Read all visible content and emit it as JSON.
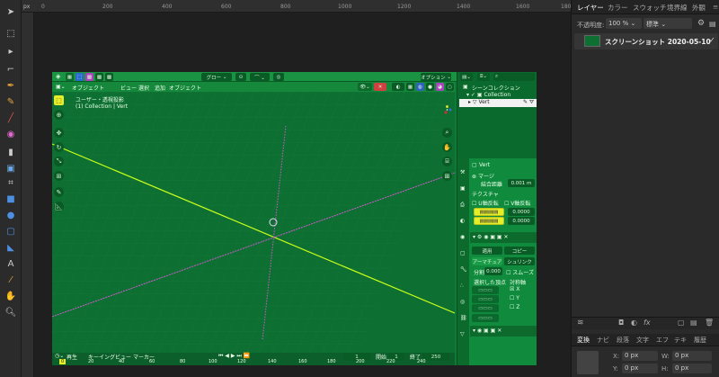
{
  "ruler": {
    "unit": "px",
    "h_ticks": [
      "0",
      "200",
      "400",
      "600",
      "800",
      "1000",
      "1200",
      "1400",
      "1600",
      "1800"
    ]
  },
  "layers_panel": {
    "tabs": [
      "レイヤー",
      "カラー",
      "スウォッチ",
      "境界線",
      "外観"
    ],
    "opacity_label": "不透明度:",
    "opacity_value": "100 %",
    "blend_mode": "標準",
    "layer_name": "スクリーンショット 2020-05-10",
    "layer_check": "✓"
  },
  "transform_panel": {
    "tabs": [
      "変換",
      "ナビ",
      "段落",
      "文字",
      "エフ",
      "テキ",
      "履歴"
    ],
    "x_label": "X:",
    "x_value": "0 px",
    "y_label": "Y:",
    "y_value": "0 px",
    "w_label": "W:",
    "w_value": "0 px",
    "h_label": "H:",
    "h_value": "0 px"
  },
  "blender": {
    "header_menus": [
      "オブジェクト",
      "ビュー",
      "選択",
      "追加",
      "オブジェクト"
    ],
    "transform_orientation": "グロー",
    "options_label": "オプション",
    "viewport_info_line1": "ユーザー・透視投影",
    "viewport_info_line2": "(1) Collection | Vert",
    "timeline_menus": [
      "再生",
      "キーイング",
      "ビュー",
      "マーカー"
    ],
    "timeline_current_frame": "1",
    "timeline_start_label": "開始",
    "timeline_start": "1",
    "timeline_end_label": "終了",
    "timeline_end": "250",
    "timeline_ticks": [
      "0",
      "20",
      "40",
      "60",
      "80",
      "100",
      "120",
      "140",
      "160",
      "180",
      "200",
      "220",
      "240"
    ],
    "outliner": {
      "title": "シーンコレクション",
      "collection": "Collection",
      "object": "Vert"
    },
    "props": {
      "object_name": "Vert",
      "section_merge": "マージ",
      "merge_label": "結合距離",
      "merge_value": "0.001 m",
      "section_texture": "テクスチャ",
      "u_label": "U軸反転",
      "v_label": "V軸反転",
      "field1": "0.0000",
      "field2": "0.0000",
      "apply_label": "適用",
      "copy_label": "コピー",
      "armature_label": "アーマチュア",
      "shrinkwrap_label": "シュリンク",
      "subdiv_label": "分割",
      "subdiv_value": "0.000",
      "smooth_label": "スムーズ",
      "selected_vertices": "選択した頂点",
      "axis_label": "対称軸",
      "x": "X",
      "y": "Y",
      "z": "Z"
    }
  },
  "colors": {
    "blender_green": "#0e6f32",
    "wire_yellow": "#c8ff1a",
    "wire_magenta": "#d05ad0",
    "app_bg": "#1e1e1e"
  }
}
